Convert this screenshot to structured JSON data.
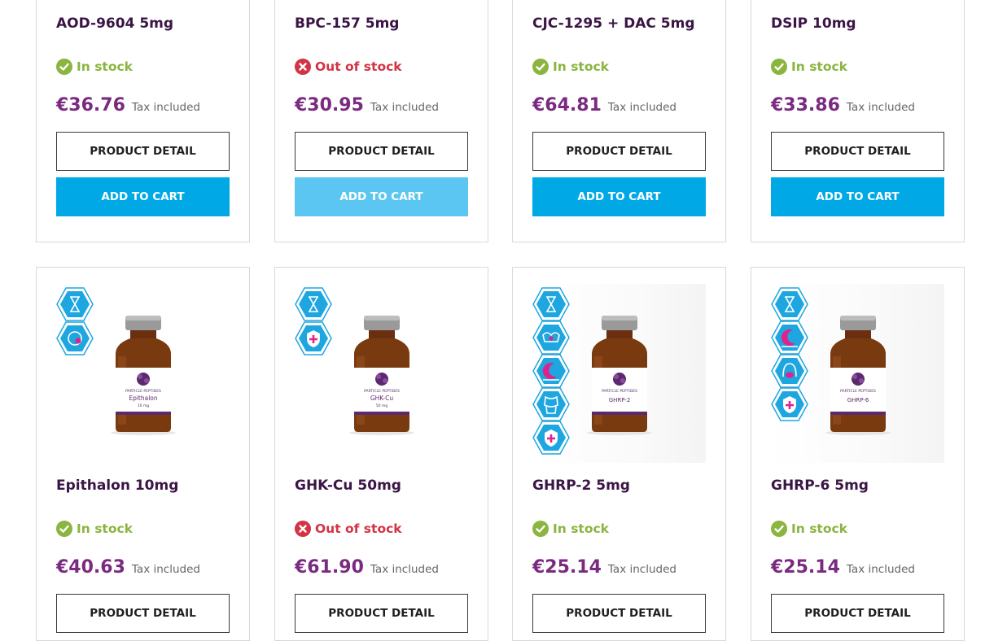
{
  "products": [
    {
      "name": "AOD-9604 5mg",
      "stock_status": "in",
      "stock_text": "In stock",
      "price": "€36.76",
      "tax": "Tax included",
      "detail_label": "PRODUCT DETAIL",
      "cart_label": "ADD TO CART",
      "cart_enabled": true
    },
    {
      "name": "BPC-157 5mg",
      "stock_status": "out",
      "stock_text": "Out of stock",
      "price": "€30.95",
      "tax": "Tax included",
      "detail_label": "PRODUCT DETAIL",
      "cart_label": "ADD TO CART",
      "cart_enabled": false
    },
    {
      "name": "CJC-1295 + DAC 5mg",
      "stock_status": "in",
      "stock_text": "In stock",
      "price": "€64.81",
      "tax": "Tax included",
      "detail_label": "PRODUCT DETAIL",
      "cart_label": "ADD TO CART",
      "cart_enabled": true
    },
    {
      "name": "DSIP 10mg",
      "stock_status": "in",
      "stock_text": "In stock",
      "price": "€33.86",
      "tax": "Tax included",
      "detail_label": "PRODUCT DETAIL",
      "cart_label": "ADD TO CART",
      "cart_enabled": true
    },
    {
      "name": "Epithalon 10mg",
      "stock_status": "in",
      "stock_text": "In stock",
      "price": "€40.63",
      "tax": "Tax included",
      "detail_label": "PRODUCT DETAIL",
      "vial_brand": "PARTICLE PEPTIDES",
      "vial_label": "Epithalon",
      "vial_dose": "10 mg",
      "badges": [
        "hourglass-icon",
        "brain-icon"
      ]
    },
    {
      "name": "GHK-Cu 50mg",
      "stock_status": "out",
      "stock_text": "Out of stock",
      "price": "€61.90",
      "tax": "Tax included",
      "detail_label": "PRODUCT DETAIL",
      "vial_brand": "PARTICLE PEPTIDES",
      "vial_label": "GHK-Cu",
      "vial_dose": "50 mg",
      "badges": [
        "hourglass-icon",
        "shield-plus-icon"
      ]
    },
    {
      "name": "GHRP-2 5mg",
      "stock_status": "in",
      "stock_text": "In stock",
      "price": "€25.14",
      "tax": "Tax included",
      "detail_label": "PRODUCT DETAIL",
      "vial_brand": "PARTICLE PEPTIDES",
      "vial_label": "GHRP-2",
      "vial_dose": "",
      "badges": [
        "hourglass-icon",
        "muscle-icon",
        "moon-icon",
        "body-icon",
        "shield-plus-icon"
      ]
    },
    {
      "name": "GHRP-6 5mg",
      "stock_status": "in",
      "stock_text": "In stock",
      "price": "€25.14",
      "tax": "Tax included",
      "detail_label": "PRODUCT DETAIL",
      "vial_brand": "PARTICLE PEPTIDES",
      "vial_label": "GHRP-6",
      "vial_dose": "",
      "badges": [
        "hourglass-icon",
        "moon-icon",
        "stomach-icon",
        "shield-plus-icon"
      ]
    }
  ],
  "colors": {
    "in_stock": "#8ab53f",
    "out_of_stock": "#d23444",
    "price": "#7a2a80",
    "title": "#3a1545",
    "cart_button": "#00a9e6",
    "cart_button_disabled": "#5cc6f2",
    "badge_blue": "#1ea6e0",
    "vial_glass": "#7a3a10",
    "vial_label_purple": "#5b2a6e"
  }
}
